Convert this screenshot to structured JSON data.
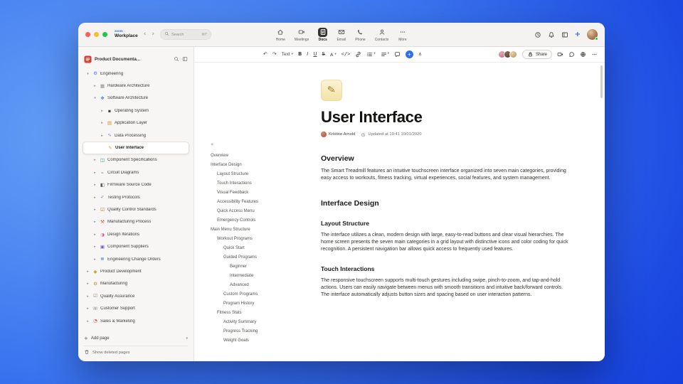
{
  "accent_color": "#2e6df6",
  "topbar": {
    "brand": {
      "top": "zoom",
      "bottom": "Workplace"
    },
    "search": {
      "label": "Search",
      "shortcut": "⌘F"
    },
    "nav": [
      {
        "label": "Home",
        "icon": "home-icon"
      },
      {
        "label": "Meetings",
        "icon": "meetings-icon"
      },
      {
        "label": "Docs",
        "icon": "docs-icon",
        "active": true
      },
      {
        "label": "Email",
        "icon": "email-icon"
      },
      {
        "label": "Phone",
        "icon": "phone-icon"
      },
      {
        "label": "Contacts",
        "icon": "contacts-icon"
      },
      {
        "label": "More",
        "icon": "more-icon"
      }
    ]
  },
  "sidebar": {
    "title": "Product Documenta...",
    "tree": [
      {
        "label": "Engineering",
        "level": 0,
        "chevron": "down",
        "icon": "gear-icon",
        "glyph": "⚙",
        "color": "#4f6bed"
      },
      {
        "label": "Hardware Architecture",
        "level": 1,
        "chevron": "right",
        "icon": "chip-icon",
        "glyph": "▦",
        "color": "#8a8886"
      },
      {
        "label": "Software Architecture",
        "level": 1,
        "chevron": "down",
        "icon": "diamond-module-icon",
        "glyph": "❖",
        "color": "#3f7de0"
      },
      {
        "label": "Operating System",
        "level": 2,
        "chevron": "right",
        "icon": "device-icon",
        "glyph": "▪",
        "color": "#444240"
      },
      {
        "label": "Application Layer",
        "level": 2,
        "chevron": "right",
        "icon": "layers-icon",
        "glyph": "▤",
        "color": "#e08a2d"
      },
      {
        "label": "Data Processing",
        "level": 2,
        "chevron": "right",
        "icon": "wave-icon",
        "glyph": "∿",
        "color": "#7c5bd6"
      },
      {
        "label": "User Interface",
        "level": 2,
        "chevron": null,
        "icon": "pencil-doc-icon",
        "glyph": "✎",
        "color": "#e0a32d",
        "selected": true
      },
      {
        "label": "Component Specifications",
        "level": 1,
        "chevron": "right",
        "icon": "spec-icon",
        "glyph": "◫",
        "color": "#2f9e8f"
      },
      {
        "label": "Circuit Diagrams",
        "level": 1,
        "chevron": "right",
        "icon": "circuit-icon",
        "glyph": "⌁",
        "color": "#3f9e4d"
      },
      {
        "label": "Firmware Source Code",
        "level": 1,
        "chevron": "right",
        "icon": "code-file-icon",
        "glyph": "◧",
        "color": "#5c5a58"
      },
      {
        "label": "Testing Protocols",
        "level": 1,
        "chevron": "right",
        "icon": "check-icon",
        "glyph": "✓",
        "color": "#3f6bd0"
      },
      {
        "label": "Quality Control Standards",
        "level": 1,
        "chevron": "right",
        "icon": "checklist-icon",
        "glyph": "☑",
        "color": "#b3791f"
      },
      {
        "label": "Manufacturing Process",
        "level": 1,
        "chevron": "right",
        "icon": "hammer-icon",
        "glyph": "⚒",
        "color": "#c2612f"
      },
      {
        "label": "Design Iterations",
        "level": 1,
        "chevron": "right",
        "icon": "palette-icon",
        "glyph": "◑",
        "color": "#d45a9e"
      },
      {
        "label": "Component Suppliers",
        "level": 1,
        "chevron": "right",
        "icon": "box-icon",
        "glyph": "▣",
        "color": "#7a5bd6"
      },
      {
        "label": "Engineering Change Orders",
        "level": 1,
        "chevron": "right",
        "icon": "list-doc-icon",
        "glyph": "≣",
        "color": "#3f7de0"
      },
      {
        "label": "Product Development",
        "level": 0,
        "chevron": "right",
        "icon": "diamond-icon",
        "glyph": "◆",
        "color": "#caa52f"
      },
      {
        "label": "Manufacturing",
        "level": 0,
        "chevron": "right",
        "icon": "factory-icon",
        "glyph": "⚙",
        "color": "#b08a2f"
      },
      {
        "label": "Quality Assurance",
        "level": 0,
        "chevron": "right",
        "icon": "qa-icon",
        "glyph": "☑",
        "color": "#8a8886"
      },
      {
        "label": "Customer Support",
        "level": 0,
        "chevron": "right",
        "icon": "support-icon",
        "glyph": "☏",
        "color": "#6f6d6b"
      },
      {
        "label": "Sales & Marketing",
        "level": 0,
        "chevron": "right",
        "icon": "chart-icon",
        "glyph": "◔",
        "color": "#c24b3a"
      }
    ],
    "footer": {
      "add_page": "Add page",
      "show_deleted": "Show deleted pages"
    }
  },
  "toolbar": {
    "text_style": "Text",
    "share": "Share"
  },
  "outline": {
    "items": [
      {
        "label": "Overview",
        "level": 0
      },
      {
        "label": "Interface Design",
        "level": 0
      },
      {
        "label": "Layout Structure",
        "level": 1
      },
      {
        "label": "Touch Interactions",
        "level": 1
      },
      {
        "label": "Visual Feedback",
        "level": 1
      },
      {
        "label": "Accessibility Features",
        "level": 1
      },
      {
        "label": "Quick Access Menu",
        "level": 1
      },
      {
        "label": "Emergency Controls",
        "level": 1
      },
      {
        "label": "Main Menu Structure",
        "level": 0
      },
      {
        "label": "Workout Programs",
        "level": 1
      },
      {
        "label": "Quick Start",
        "level": 2
      },
      {
        "label": "Guided Programs",
        "level": 2
      },
      {
        "label": "Beginner",
        "level": 3
      },
      {
        "label": "Intermediate",
        "level": 3
      },
      {
        "label": "Advanced",
        "level": 3
      },
      {
        "label": "Custom Programs",
        "level": 2
      },
      {
        "label": "Program History",
        "level": 2
      },
      {
        "label": "Fitness Stats",
        "level": 1
      },
      {
        "label": "Activity Summary",
        "level": 2
      },
      {
        "label": "Progress Tracking",
        "level": 2
      },
      {
        "label": "Weight Goals",
        "level": 2
      }
    ]
  },
  "doc": {
    "title": "User Interface",
    "author": "Kristine Arnold",
    "updated": "Updated at 19:41 10/01/2020",
    "blocks": [
      {
        "type": "h2",
        "text": "Overview"
      },
      {
        "type": "p",
        "text": "The Smart Treadmill features an intuitive touchscreen interface organized into seven main categories, providing easy access to workouts, fitness tracking, virtual experiences, social features, and system management."
      },
      {
        "type": "h2",
        "text": "Interface Design"
      },
      {
        "type": "h3",
        "text": "Layout Structure"
      },
      {
        "type": "p",
        "text": "The interface utilizes a clean, modern design with large, easy-to-read buttons and clear visual hierarchies. The home screen presents the seven main categories in a grid layout with distinctive icons and color coding for quick recognition. A persistent navigation bar allows quick access to frequently used features."
      },
      {
        "type": "h3",
        "text": "Touch Interactions"
      },
      {
        "type": "p",
        "text": "The responsive touchscreen supports multi-touch gestures including swipe, pinch-to-zoom, and tap-and-hold actions. Users can easily navigate between menus with smooth transitions and intuitive back/forward controls. The interface automatically adjusts button sizes and spacing based on user interaction patterns."
      }
    ]
  },
  "icons": {
    "undo-icon": "↶",
    "redo-icon": "↷",
    "caret-down-icon": "▾",
    "collapse-icon": "∧",
    "outline-collapse-icon": "«",
    "plus-icon": "+",
    "back-icon": "‹",
    "forward-icon": "›",
    "bold-icon": "B",
    "italic-icon": "I",
    "underline-icon": "U",
    "strikethrough-icon": "S",
    "text-color-icon": "A",
    "code-icon": "</>",
    "pencil-glyph": "✎"
  }
}
